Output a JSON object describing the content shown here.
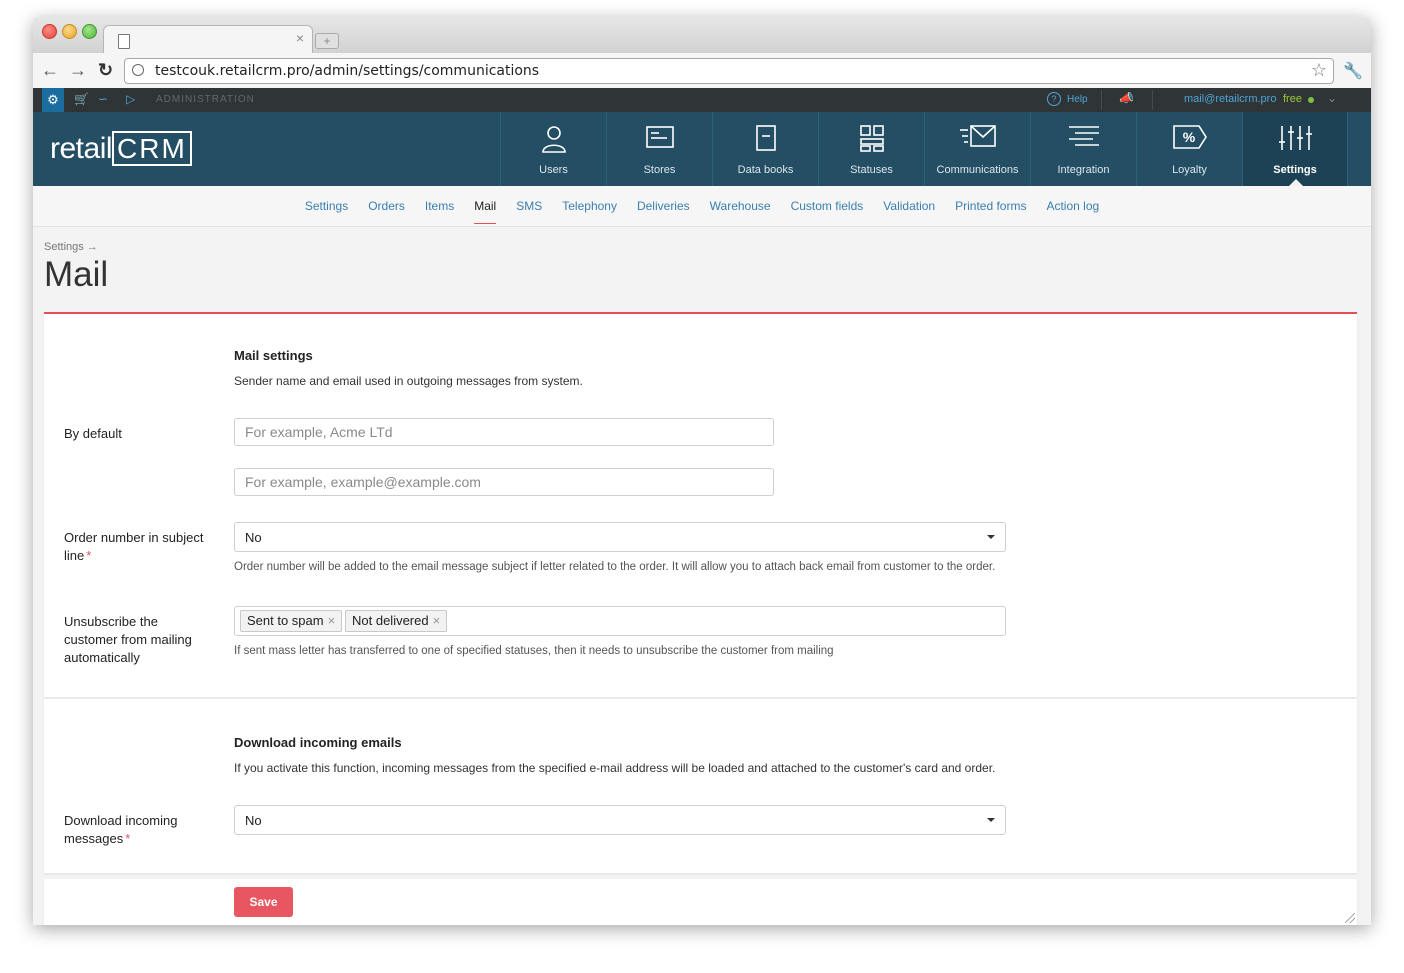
{
  "browser": {
    "url": "testcouk.retailcrm.pro/admin/settings/communications",
    "tab_close": "×",
    "new_tab": "+"
  },
  "adminbar": {
    "section_label": "ADMINISTRATION",
    "help": "Help",
    "user_email": "mail@retailcrm.pro",
    "plan": "free"
  },
  "header": {
    "logo_prefix": "retail",
    "logo_suffix": "CRM",
    "modules": [
      {
        "label": "Users",
        "icon": "user-icon"
      },
      {
        "label": "Stores",
        "icon": "store-icon"
      },
      {
        "label": "Data books",
        "icon": "book-icon"
      },
      {
        "label": "Statuses",
        "icon": "statuses-icon"
      },
      {
        "label": "Communications",
        "icon": "mail-icon"
      },
      {
        "label": "Integration",
        "icon": "integration-icon"
      },
      {
        "label": "Loyalty",
        "icon": "percent-tag-icon"
      },
      {
        "label": "Settings",
        "icon": "sliders-icon"
      }
    ],
    "active_module": "Settings"
  },
  "subnav": {
    "items": [
      "Settings",
      "Orders",
      "Items",
      "Mail",
      "SMS",
      "Telephony",
      "Deliveries",
      "Warehouse",
      "Custom fields",
      "Validation",
      "Printed forms",
      "Action log"
    ],
    "active": "Mail"
  },
  "page": {
    "breadcrumb": "Settings →",
    "title": "Mail"
  },
  "mail_settings": {
    "title": "Mail settings",
    "description": "Sender name and email used in outgoing messages from system.",
    "default_label": "By default",
    "name_placeholder": "For example, Acme LTd",
    "email_placeholder": "For example, example@example.com",
    "order_number_label": "Order number in subject line",
    "order_number_value": "No",
    "order_number_help": "Order number will be added to the email message subject if letter related to the order. It will allow you to attach back email from customer to the order.",
    "unsubscribe_label": "Unsubscribe the customer from mailing automatically",
    "unsubscribe_tags": [
      "Sent to spam",
      "Not delivered"
    ],
    "unsubscribe_help": "If sent mass letter has transferred to one of specified statuses, then it needs to unsubscribe the customer from mailing"
  },
  "incoming": {
    "title": "Download incoming emails",
    "description": "If you activate this function, incoming messages from the specified e-mail address will be loaded and attached to the customer's card and order.",
    "download_label": "Download incoming messages",
    "download_value": "No"
  },
  "actions": {
    "save": "Save",
    "required_mark": "*"
  },
  "colors": {
    "header_bg": "#244e64",
    "accent_red": "#e85761",
    "link_blue": "#3a7fb0"
  }
}
